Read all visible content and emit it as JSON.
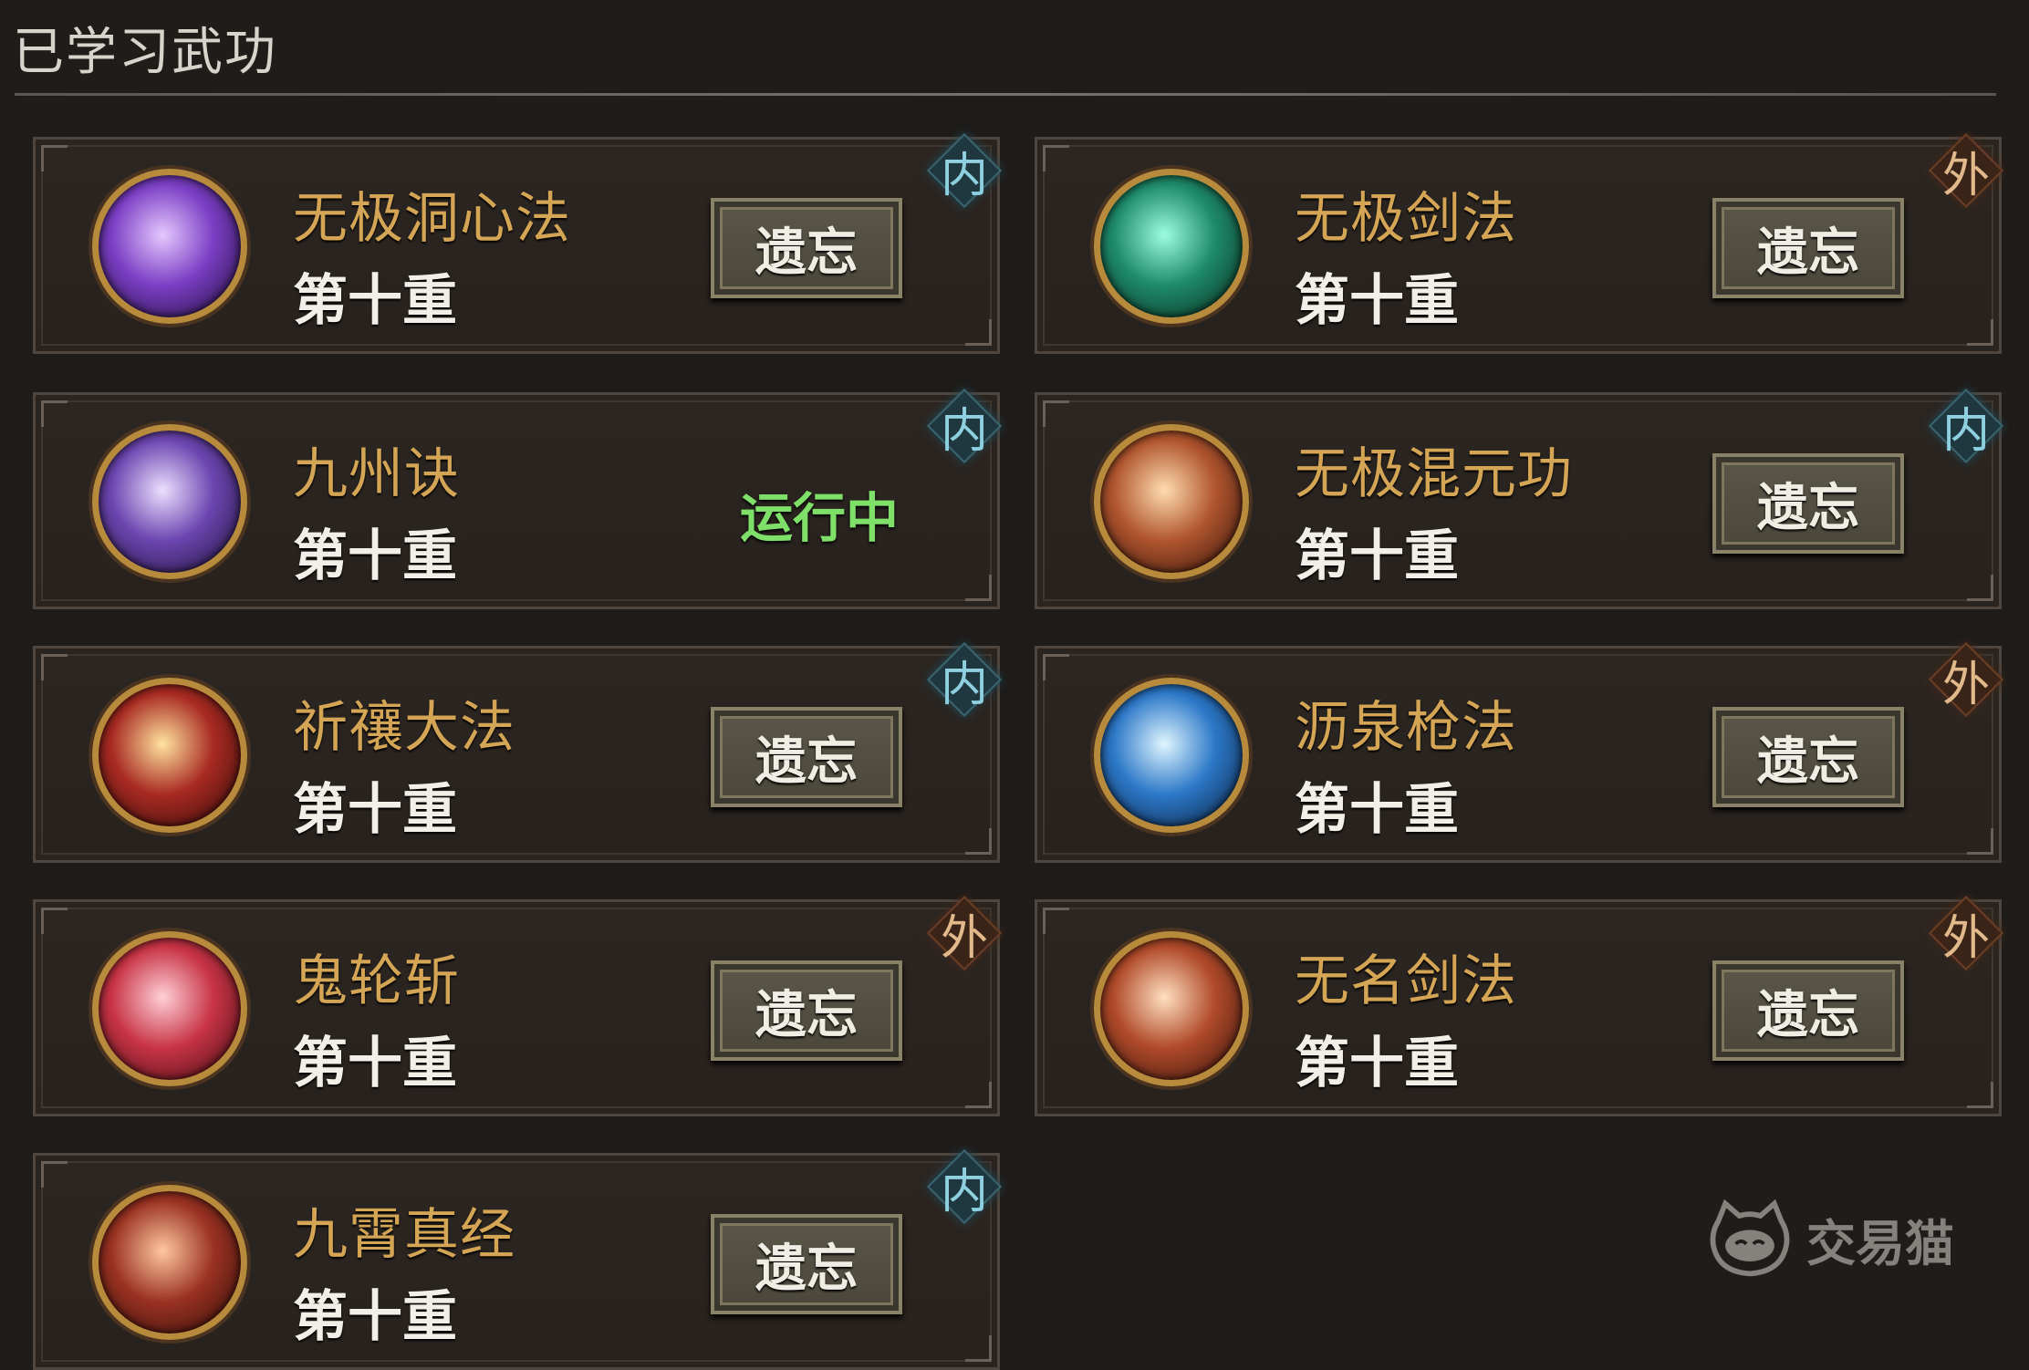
{
  "header": {
    "title": "已学习武功"
  },
  "actions": {
    "forget_label": "遗忘"
  },
  "skills": [
    {
      "name": "无极洞心法",
      "level": "第十重",
      "type": "内",
      "status": "",
      "colors": [
        "#e6c8ff",
        "#7a3ec4",
        "#1a0b2e"
      ]
    },
    {
      "name": "无极剑法",
      "level": "第十重",
      "type": "外",
      "status": "",
      "colors": [
        "#9dfce0",
        "#1e8a6a",
        "#082418"
      ]
    },
    {
      "name": "九州诀",
      "level": "第十重",
      "type": "内",
      "status": "运行中",
      "colors": [
        "#ece0ff",
        "#6c45b0",
        "#190f30"
      ]
    },
    {
      "name": "无极混元功",
      "level": "第十重",
      "type": "内",
      "status": "",
      "colors": [
        "#ffdcb0",
        "#b0552e",
        "#2a0e08"
      ]
    },
    {
      "name": "祈禳大法",
      "level": "第十重",
      "type": "内",
      "status": "",
      "colors": [
        "#ffe3a0",
        "#a82a22",
        "#2a0808"
      ]
    },
    {
      "name": "沥泉枪法",
      "level": "第十重",
      "type": "外",
      "status": "",
      "colors": [
        "#e0f6ff",
        "#2c78c8",
        "#081a34"
      ]
    },
    {
      "name": "鬼轮斩",
      "level": "第十重",
      "type": "外",
      "status": "",
      "colors": [
        "#ffd0d6",
        "#c83446",
        "#3a080e"
      ]
    },
    {
      "name": "无名剑法",
      "level": "第十重",
      "type": "外",
      "status": "",
      "colors": [
        "#ffe0c0",
        "#b04a2a",
        "#30100a"
      ]
    },
    {
      "name": "九霄真经",
      "level": "第十重",
      "type": "内",
      "status": "",
      "colors": [
        "#ffc8a0",
        "#9a3222",
        "#2a0a08"
      ]
    }
  ],
  "watermark": {
    "text": "交易猫"
  }
}
